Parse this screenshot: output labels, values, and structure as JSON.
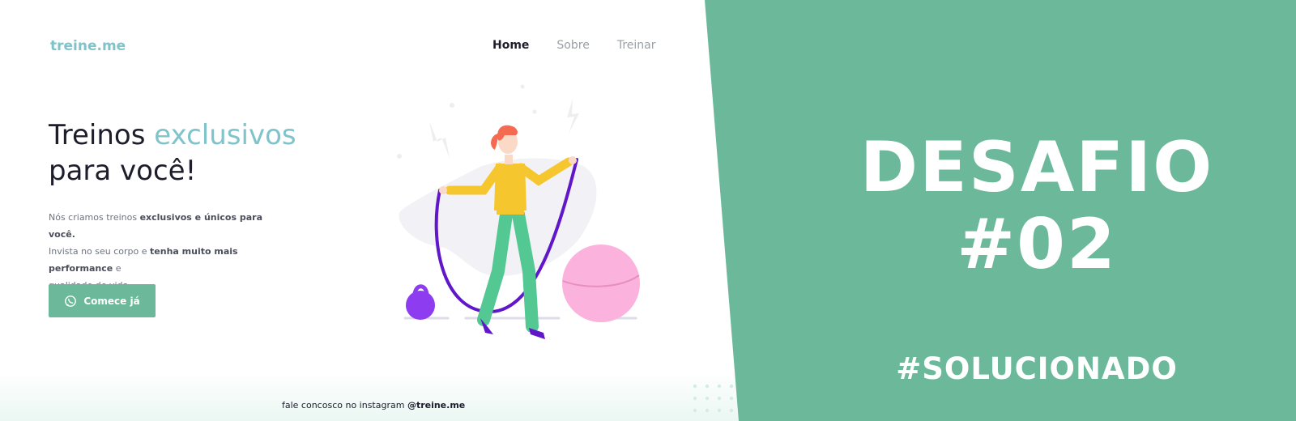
{
  "brand": {
    "logo": "treine.me",
    "accent": "#7fc3cb",
    "green": "#6bb99a"
  },
  "nav": {
    "items": [
      "Home",
      "Sobre",
      "Treinar"
    ],
    "active": "Home"
  },
  "hero": {
    "headline_plain_1": "Treinos ",
    "headline_accent": "exclusivos",
    "headline_line_2": "para você!",
    "lead_1": "Nós criamos treinos ",
    "lead_1_bold": "exclusivos e únicos para você.",
    "lead_2": "Invista no seu corpo e ",
    "lead_2_bold": "tenha muito mais performance",
    "lead_2_end": " e",
    "lead_3": "qualidade de vida.",
    "cta_label": "Comece já",
    "cta_icon": "whatsapp-icon"
  },
  "footer": {
    "text": "fale concosco no instagram ",
    "handle": "@treine.me"
  },
  "banner": {
    "title_1": "DESAFIO",
    "title_2": "#02",
    "subtitle": "#SOLUCIONADO",
    "background": "#6bb99a"
  }
}
